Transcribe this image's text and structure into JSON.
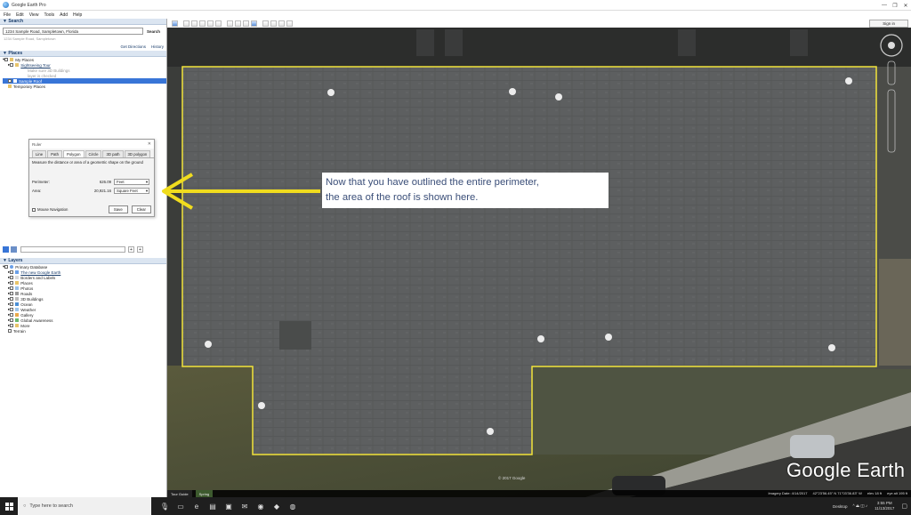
{
  "window": {
    "title": "Google Earth Pro",
    "controls": [
      "—",
      "❐",
      "✕"
    ]
  },
  "menu": [
    "File",
    "Edit",
    "View",
    "Tools",
    "Add",
    "Help"
  ],
  "search": {
    "header": "Search",
    "value": "1234 Sample Road, Sampletown, Florida",
    "button": "Search",
    "sub": "1234 Sample Road, Sampletown",
    "get_directions": "Get Directions",
    "history": "History"
  },
  "places": {
    "header": "Places",
    "items": [
      {
        "label": "My Places",
        "state": "normal"
      },
      {
        "label": "Sightseeing Tour",
        "state": "link"
      },
      {
        "label": "Make sure 3D Buildings",
        "state": "dim"
      },
      {
        "label": "layer is checked",
        "state": "dim"
      },
      {
        "label": "Sample Roof",
        "state": "selected"
      },
      {
        "label": "Temporary Places",
        "state": "normal"
      }
    ]
  },
  "ruler": {
    "title": "Ruler",
    "close": "✕",
    "tabs": [
      "Line",
      "Path",
      "Polygon",
      "Circle",
      "3D path",
      "3D polygon"
    ],
    "active_tab": "Polygon",
    "description": "Measure the distance or area of a geometric shape on the ground",
    "perimeter_label": "Perimeter:",
    "perimeter_value": "626.09",
    "perimeter_unit": "Feet",
    "area_label": "Area:",
    "area_value": "20,921.16",
    "area_unit": "Square Feet",
    "mouse_nav": "Mouse Navigation",
    "save": "Save",
    "clear": "Clear"
  },
  "callout": {
    "line1": "Now that you have outlined the entire perimeter,",
    "line2": "the area of the roof is shown here."
  },
  "layers": {
    "header": "Layers",
    "items": [
      {
        "label": "Primary Database",
        "link": false
      },
      {
        "label": "The new Google Earth",
        "link": true
      },
      {
        "label": "Borders and Labels",
        "link": false
      },
      {
        "label": "Places",
        "link": false
      },
      {
        "label": "Photos",
        "link": false
      },
      {
        "label": "Roads",
        "link": false
      },
      {
        "label": "3D Buildings",
        "link": false
      },
      {
        "label": "Ocean",
        "link": false
      },
      {
        "label": "Weather",
        "link": false
      },
      {
        "label": "Gallery",
        "link": false
      },
      {
        "label": "Global Awareness",
        "link": false
      },
      {
        "label": "More",
        "link": false
      },
      {
        "label": "Terrain",
        "link": false
      }
    ]
  },
  "toolbar": {
    "sign_in": "Sign in"
  },
  "map": {
    "logo": "Google Earth",
    "copyright": "© 2017 Google",
    "tour_guide": "Tour Guide",
    "tour_thumb": "Spring",
    "imagery_date": "Imagery Date: 4/14/2017",
    "coords": "42°23'56.45\" N   71°03'36.83\" W",
    "elev": "elev  18 ft",
    "eye_alt": "eye alt  195 ft",
    "outline_color": "#f2e33a"
  },
  "taskbar": {
    "search_placeholder": "Type here to search",
    "tray_label": "Desktop",
    "time": "3:55 PM",
    "date": "11/13/2017"
  }
}
